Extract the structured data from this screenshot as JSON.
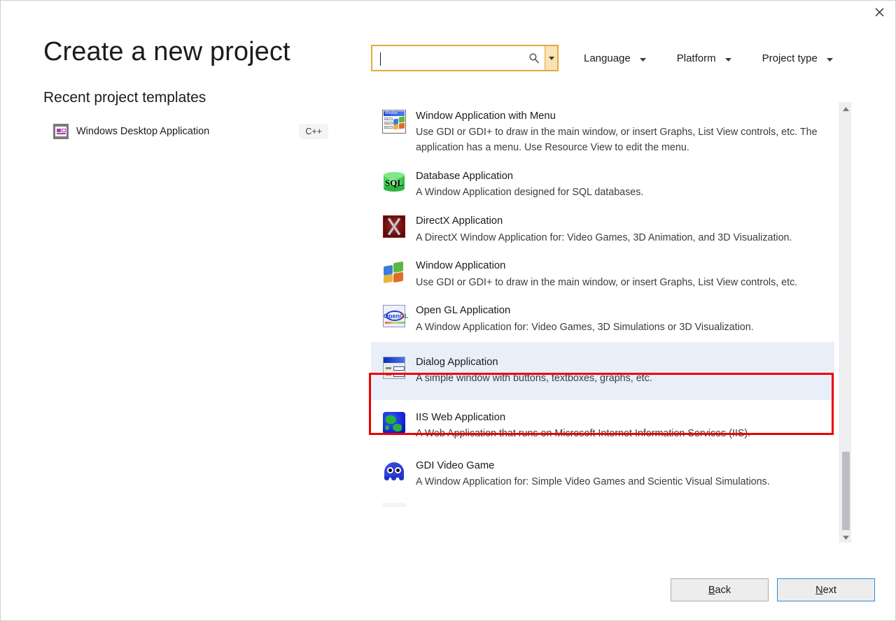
{
  "window": {
    "close_label": "Close",
    "close_icon": "close-icon"
  },
  "header": {
    "title": "Create a new project"
  },
  "recent": {
    "heading": "Recent project templates",
    "items": [
      {
        "label": "Windows Desktop Application",
        "language": "C++",
        "icon": "windows-desktop-icon"
      }
    ]
  },
  "search": {
    "value": "",
    "placeholder": "",
    "icon": "search-icon",
    "dropdown_icon": "chevron-down-icon",
    "border_color": "#e3a93c",
    "dropdown_bg": "#fbe2b4"
  },
  "filters": [
    {
      "label": "Language",
      "icon": "chevron-down-icon"
    },
    {
      "label": "Platform",
      "icon": "chevron-down-icon"
    },
    {
      "label": "Project type",
      "icon": "chevron-down-icon"
    }
  ],
  "templates": [
    {
      "name": "Window Application with Menu",
      "description": "Use GDI or GDI+ to draw in the main window, or insert Graphs, List View controls, etc. The application has a menu.  Use Resource View to edit the menu.",
      "icon": "window-with-menu-icon",
      "selected": false
    },
    {
      "name": "Database Application",
      "description": "A Window Application designed for SQL databases.",
      "icon": "sql-database-icon",
      "selected": false
    },
    {
      "name": "DirectX Application",
      "description": "A DirectX Window Application for: Video Games, 3D Animation, and 3D Visualization.",
      "icon": "directx-icon",
      "selected": false
    },
    {
      "name": "Window Application",
      "description": "Use GDI or GDI+ to draw in the main window, or insert Graphs, List View controls, etc.",
      "icon": "windows-flag-icon",
      "selected": false
    },
    {
      "name": "Open GL Application",
      "description": "A Window Application for: Video Games, 3D Simulations or 3D Visualization.",
      "icon": "opengl-icon",
      "selected": false
    },
    {
      "name": "Dialog Application",
      "description": "A simple window with buttons, textboxes, graphs, etc.",
      "icon": "dialog-window-icon",
      "selected": true
    },
    {
      "name": "IIS Web Application",
      "description": "A Web Application that runs on Microsoft Internet Information Services (IIS).",
      "icon": "globe-icon",
      "selected": false
    },
    {
      "name": "GDI Video Game",
      "description": "A Window Application for: Simple Video Games and Scientic Visual Simulations.",
      "icon": "ghost-game-icon",
      "selected": false
    }
  ],
  "selection_highlight": {
    "color": "#ee0000",
    "target": "Dialog Application"
  },
  "scrollbar": {
    "up_icon": "triangle-up-icon",
    "down_icon": "triangle-down-icon"
  },
  "footer": {
    "back": {
      "accel": "B",
      "rest": "ack"
    },
    "next": {
      "accel": "N",
      "rest": "ext"
    }
  }
}
